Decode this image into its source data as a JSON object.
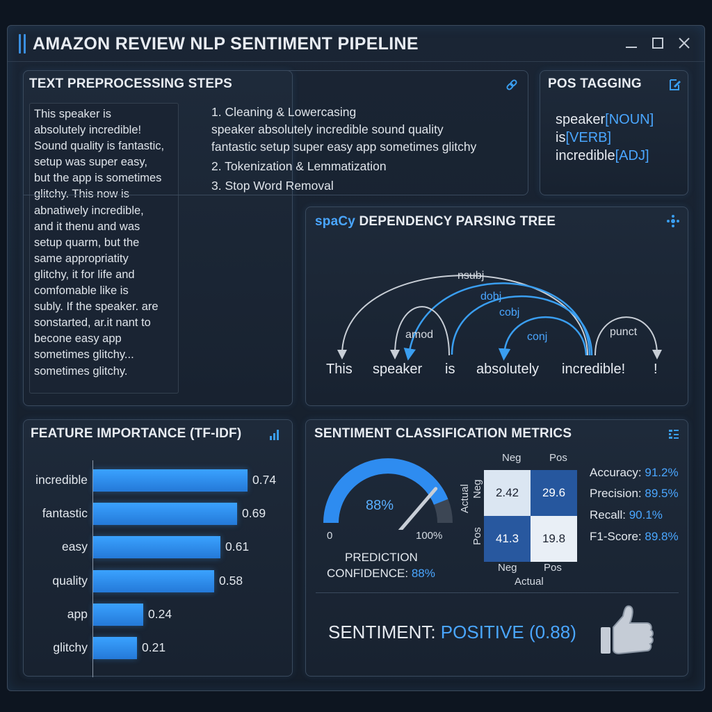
{
  "window": {
    "title": "AMAZON REVIEW NLP SENTIMENT PIPELINE"
  },
  "preprocessing": {
    "title": "TEXT PREPROCESSING STEPS",
    "icon": "link-icon",
    "review_lines": [
      "This speaker is",
      "absolutely incredible!",
      "Sound quality is fantastic,",
      "setup was super easy,",
      "but the app is sometimes",
      "glitchy. This now is",
      "abnatiwely incredible,",
      "and it thenu and was",
      "setup quarm, but the",
      "same appropriatity",
      "glitchy, it for life and",
      "comfomable like is",
      "subly. If the speaker. are",
      "sonstarted, ar.it nant to",
      "becone easy app",
      "sometimes glitchy...",
      "sometimes glitchy."
    ],
    "step1": "1. Cleaning & Lowercasing",
    "step1_output_1": "speaker absolutely incredible sound quality",
    "step1_output_2": "fantastic setup super easy app sometimes glitchy",
    "step2": "2. Tokenization & Lemmatization",
    "step3": "3. Stop Word Removal"
  },
  "pos": {
    "title": "POS TAGGING",
    "icon": "edit-icon",
    "items": [
      {
        "word": "speaker",
        "tag": "[NOUN]"
      },
      {
        "word": "is",
        "tag": "[VERB]"
      },
      {
        "word": "incredible",
        "tag": "[ADJ]"
      }
    ]
  },
  "dependency": {
    "title_prefix": "spaCy",
    "title": "DEPENDENCY PARSING TREE",
    "icon": "network-icon",
    "tokens": [
      "This",
      "speaker",
      "is",
      "absolutely",
      "incredible!",
      "!"
    ],
    "arcs": {
      "nsubj": "nsubj",
      "dobj": "dobj",
      "cobj": "cobj",
      "amod": "amod",
      "conj": "conj",
      "punct": "punct"
    }
  },
  "features": {
    "title": "FEATURE IMPORTANCE (TF-IDF)",
    "icon": "bar-chart-icon",
    "items": [
      {
        "term": "incredible",
        "score": 0.74,
        "label": "0.74"
      },
      {
        "term": "fantastic",
        "score": 0.69,
        "label": "0.69"
      },
      {
        "term": "easy",
        "score": 0.61,
        "label": "0.61"
      },
      {
        "term": "quality",
        "score": 0.58,
        "label": "0.58"
      },
      {
        "term": "app",
        "score": 0.24,
        "label": "0.24"
      },
      {
        "term": "glitchy",
        "score": 0.21,
        "label": "0.21"
      }
    ]
  },
  "metrics": {
    "title": "SENTIMENT CLASSIFICATION METRICS",
    "icon": "list-settings-icon",
    "gauge": {
      "value": 0.88,
      "center_label": "88%",
      "min_label": "0",
      "max_label": "100%",
      "caption_1": "PREDICTION",
      "caption_2_prefix": "CONFIDENCE: ",
      "caption_2_value": "88%"
    },
    "confusion": {
      "col_neg": "Neg",
      "col_pos": "Pos",
      "row_neg": "Neg",
      "row_pos": "Pos",
      "bottom_neg": "Neg",
      "bottom_pos": "Pos",
      "side_label": "Actual",
      "bottom_label": "Actual",
      "cells": [
        "2.42",
        "29.6",
        "41.3",
        "19.8"
      ],
      "colors": [
        "#dbe6f2",
        "#26579e",
        "#28589f",
        "#e9eff6"
      ]
    },
    "scores": [
      {
        "name": "Accuracy: ",
        "value": "91.2%"
      },
      {
        "name": "Precision: ",
        "value": "89.5%"
      },
      {
        "name": "Recall: ",
        "value": "90.1%"
      },
      {
        "name": "F1-Score: ",
        "value": "89.8%"
      }
    ],
    "sentiment_prefix": "SENTIMENT: ",
    "sentiment_value": "POSITIVE (0.88)",
    "result_icon": "thumbs-up-icon"
  },
  "colors": {
    "accent": "#4aa6ff",
    "bar": "#2f8ef0",
    "panel": "#1e2a3a"
  }
}
